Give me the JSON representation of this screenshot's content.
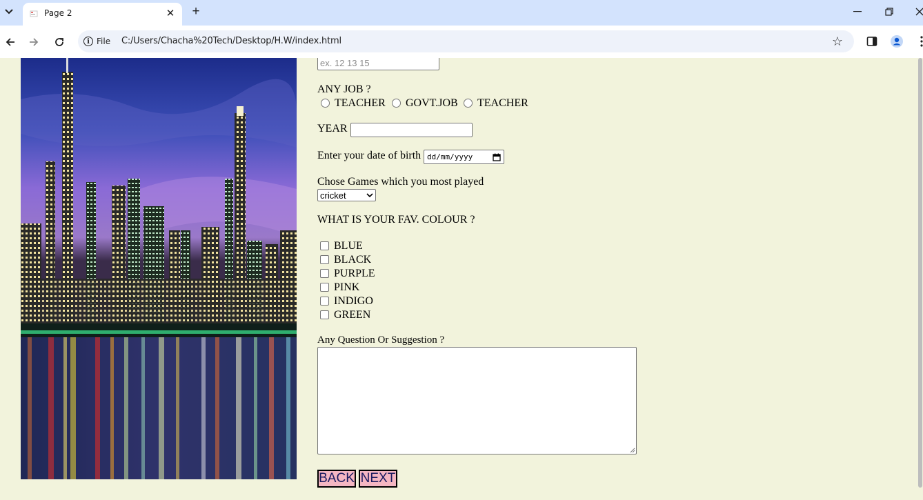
{
  "browser": {
    "tab_title": "Page 2",
    "site_chip": "File",
    "url": "C:/Users/Chacha%20Tech/Desktop/H.W/index.html"
  },
  "form": {
    "number_placeholder": "ex. 12 13 15",
    "job_question": "ANY JOB ?",
    "job_options": [
      "TEACHER",
      "GOVT.JOB",
      "TEACHER"
    ],
    "year_label": "YEAR",
    "year_value": "",
    "dob_label": "Enter your date of birth",
    "dob_placeholder": "dd/mm/yyyy",
    "games_label": "Chose Games which you most played",
    "games_selected": "cricket",
    "colour_question": "WHAT IS YOUR FAV. COLOUR ?",
    "colours": [
      "BLUE",
      "BLACK",
      "PURPLE",
      "PINK",
      "INDIGO",
      "GREEN"
    ],
    "suggestion_label": "Any Question Or Suggestion ?",
    "back_label": "BACK",
    "next_label": "NEXT"
  },
  "colors": {
    "page_background": "#f2f3dc",
    "button_background": "#f4b6c2",
    "tabstrip": "#d3e3fd"
  }
}
